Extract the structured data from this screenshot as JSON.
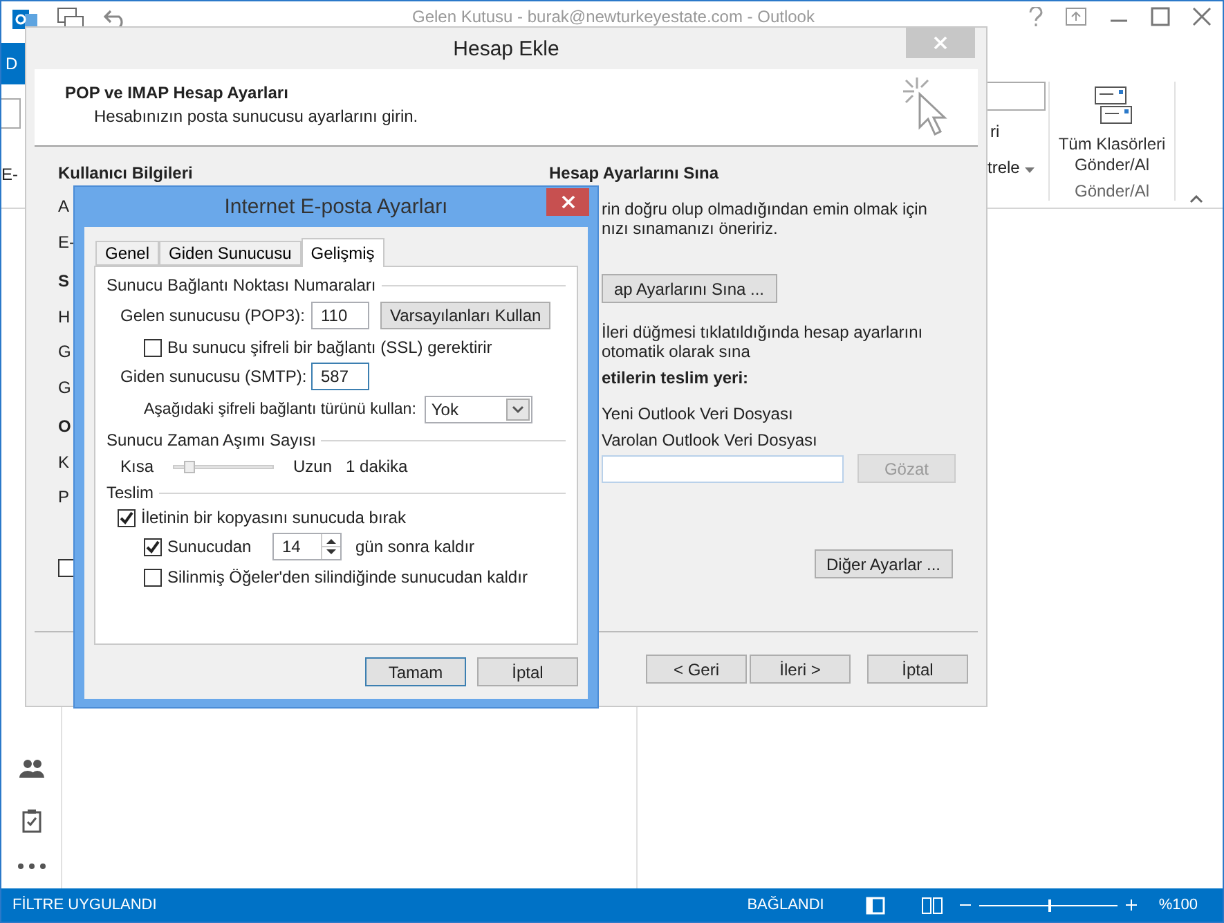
{
  "outlook": {
    "title": "Gelen Kutusu - burak@newturkeyestate.com - Outlook",
    "file_tab": "D",
    "left_fragment": "E-",
    "ribbon_fragments": [
      "ri",
      "trele"
    ],
    "send_receive_button": [
      "Tüm Klasörleri",
      "Gönder/Al"
    ],
    "group_label": "Gönder/Al",
    "status_bar": {
      "filter": "FİLTRE UYGULANDI",
      "connection": "BAĞLANDI",
      "zoom": {
        "level": 0.5,
        "reading": "%100"
      }
    }
  },
  "add_account": {
    "title": "Hesap Ekle",
    "heading": "POP ve IMAP Hesap Ayarları",
    "subheading": "Hesabınızın posta sunucusu ayarlarını girin.",
    "left_section": "Kullanıcı Bilgileri",
    "left_fragments": [
      "A",
      "E-",
      "S",
      "H",
      "G",
      "G",
      "O",
      "K",
      "P"
    ],
    "left_checkbox": {
      "checked": false
    },
    "test_heading": "Hesap Ayarlarını Sına",
    "test_text": [
      "rin doğru olup olmadığından emin olmak için",
      "nızı sınamanızı öneririz."
    ],
    "test_button": "ap Ayarlarını Sına ...",
    "auto_test": [
      "İleri düğmesi tıklatıldığında hesap ayarlarını",
      "otomatik olarak sına"
    ],
    "delivery_heading": "etilerin teslim yeri:",
    "delivery_options": [
      "Yeni Outlook Veri Dosyası",
      "Varolan Outlook Veri Dosyası"
    ],
    "browse_button": {
      "label": "Gözat",
      "disabled": true
    },
    "more_settings_button": "Diğer Ayarlar ...",
    "buttons": [
      "< Geri",
      "İleri >",
      "İptal"
    ]
  },
  "internet_settings": {
    "title": "Internet E-posta Ayarları",
    "tabs": [
      {
        "label": "Genel",
        "selected": false
      },
      {
        "label": "Giden Sunucusu",
        "selected": false
      },
      {
        "label": "Gelişmiş",
        "selected": true
      }
    ],
    "ports": {
      "heading": "Sunucu Bağlantı Noktası Numaraları",
      "incoming": {
        "label": "Gelen sunucusu (POP3):",
        "value": "110"
      },
      "defaults_button": "Varsayılanları Kullan",
      "ssl": {
        "label": "Bu sunucu şifreli bir bağlantı (SSL) gerektirir",
        "checked": false
      },
      "outgoing": {
        "label": "Giden sunucusu (SMTP):",
        "value": "587"
      },
      "encryption": {
        "label": "Aşağıdaki şifreli bağlantı türünü kullan:",
        "value": "Yok"
      }
    },
    "timeout": {
      "heading": "Sunucu Zaman Aşımı Sayısı",
      "min_label": "Kısa",
      "max_label": "Uzun",
      "level": 0.1,
      "reading": "1 dakika"
    },
    "delivery": {
      "heading": "Teslim",
      "leave_copy": {
        "label": "İletinin bir kopyasını sunucuda bırak",
        "checked": true
      },
      "remove_after": {
        "label": "Sunucudan",
        "checked": true,
        "days": "14",
        "suffix": "gün sonra kaldır"
      },
      "remove_deleted": {
        "label": "Silinmiş Öğeler'den silindiğinde sunucudan kaldır",
        "checked": false
      }
    },
    "buttons": [
      "Tamam",
      "İptal"
    ]
  }
}
